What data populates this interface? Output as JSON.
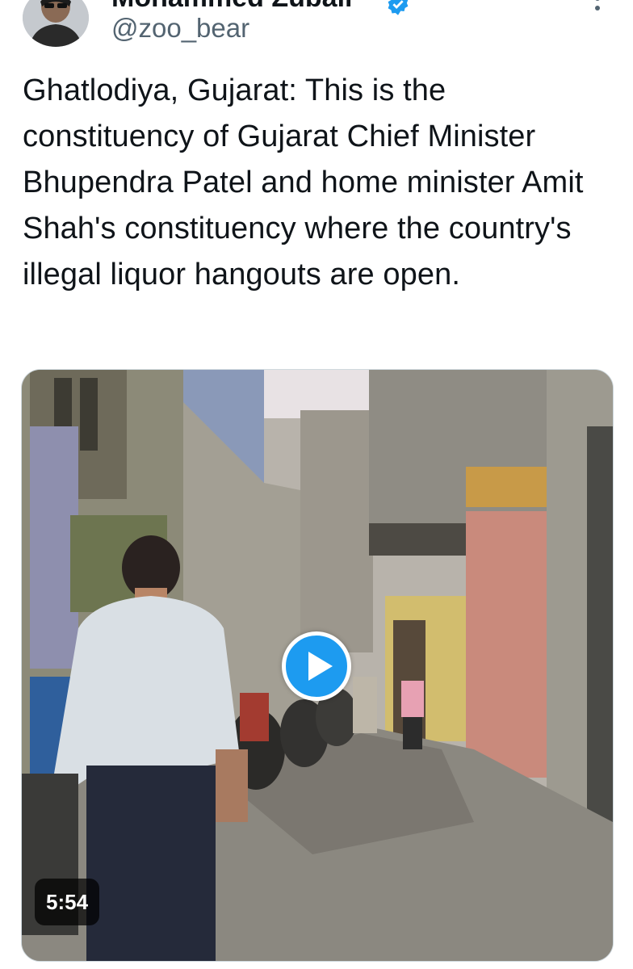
{
  "author": {
    "display_name": "Mohammed Zubair",
    "handle": "@zoo_bear",
    "verified": true,
    "avatar_icon": "user-avatar-photo"
  },
  "tweet": {
    "text": "Ghatlodiya, Gujarat: This is the constituency of Gujarat Chief Minister Bhupendra Patel and home minister Amit Shah's constituency where the country's illegal liquor hangouts are open."
  },
  "media": {
    "type": "video",
    "duration": "5:54",
    "play_icon": "play-icon"
  },
  "colors": {
    "accent": "#1d9bf0",
    "text": "#0f1419",
    "muted": "#536471"
  }
}
